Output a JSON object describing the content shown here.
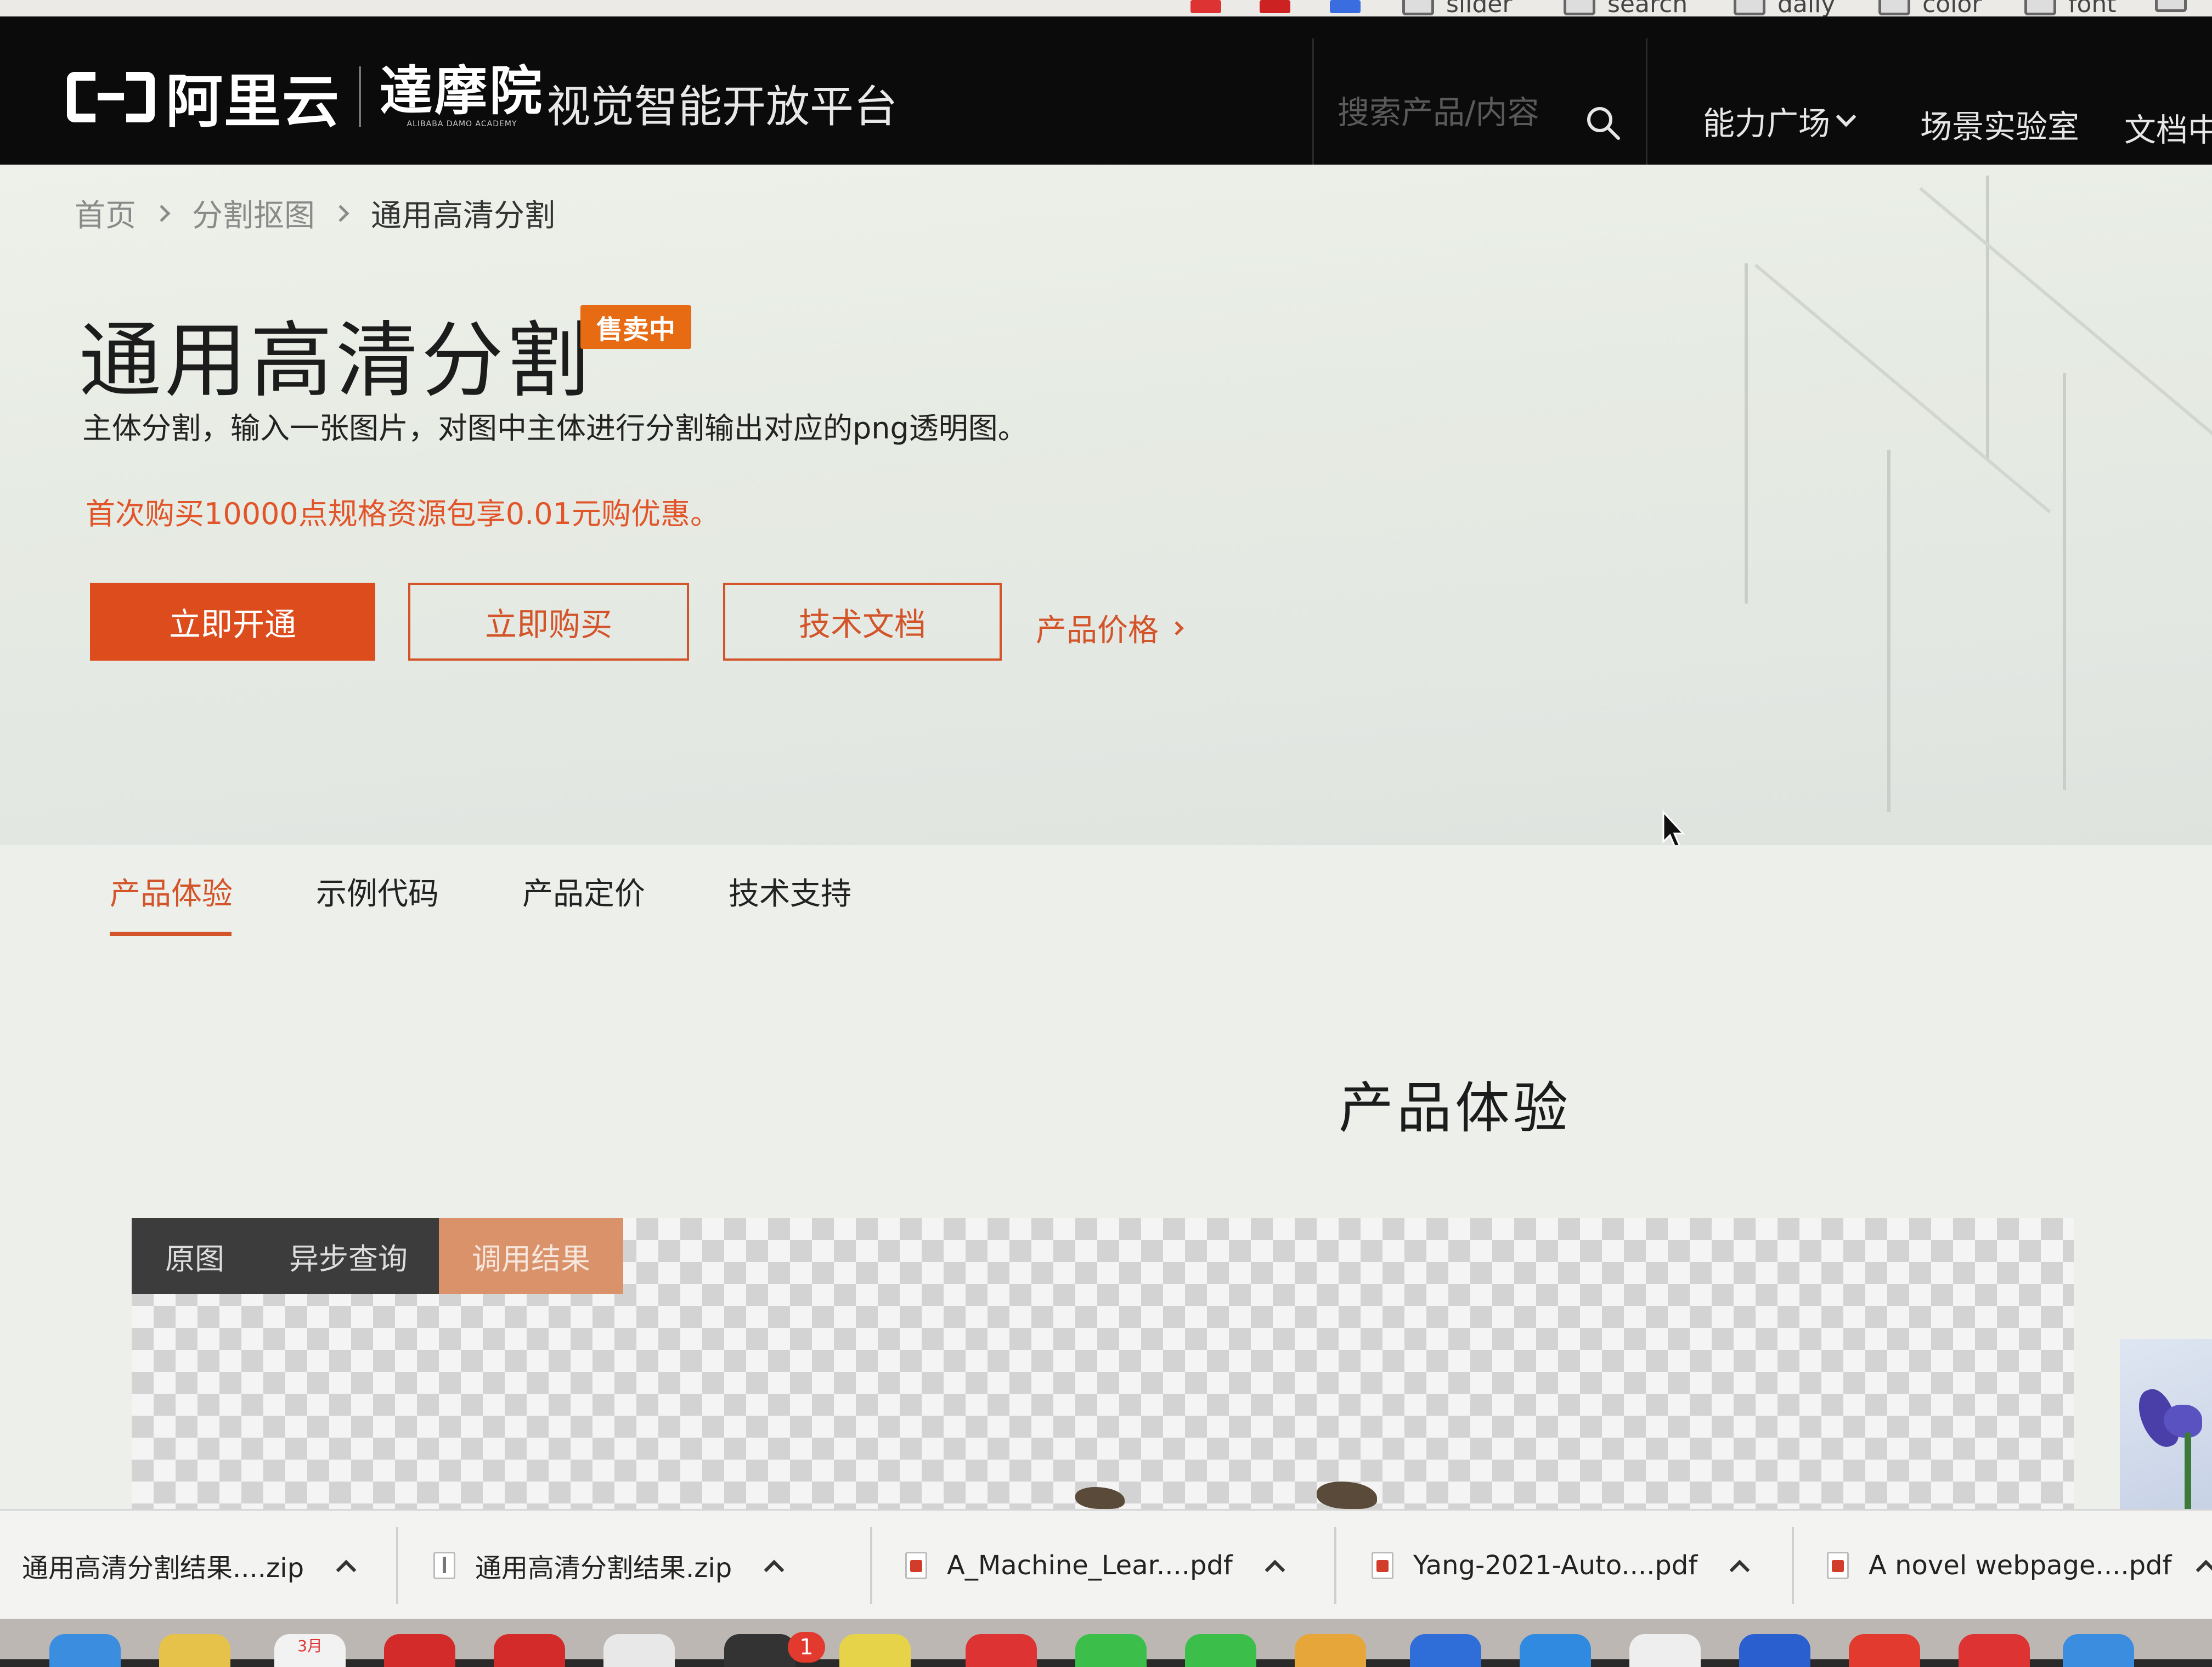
{
  "bookmarks": [
    "slider",
    "search",
    "daily",
    "color",
    "font"
  ],
  "header": {
    "logo_text": "阿里云",
    "damo_cn": "達摩院",
    "damo_en": "ALIBABA DAMO ACADEMY",
    "platform_title": "视觉智能开放平台",
    "search_placeholder": "搜索产品/内容",
    "nav": {
      "ability_square": "能力广场",
      "scene_lab": "场景实验室",
      "docs": "文档中"
    }
  },
  "breadcrumb": {
    "home": "首页",
    "category": "分割抠图",
    "current": "通用高清分割"
  },
  "product": {
    "title": "通用高清分割",
    "badge": "售卖中",
    "description": "主体分割，输入一张图片，对图中主体进行分割输出对应的png透明图。",
    "promo": "首次购买10000点规格资源包享0.01元购优惠。"
  },
  "buttons": {
    "activate": "立即开通",
    "buy": "立即购买",
    "docs": "技术文档",
    "pricing_link": "产品价格"
  },
  "tabs": [
    "产品体验",
    "示例代码",
    "产品定价",
    "技术支持"
  ],
  "active_tab": "产品体验",
  "section_title": "产品体验",
  "preview_tabs": {
    "original": "原图",
    "async_query": "异步查询",
    "result": "调用结果"
  },
  "downloads": [
    {
      "name": "通用高清分割结果....zip"
    },
    {
      "name": "通用高清分割结果.zip"
    },
    {
      "name": "A_Machine_Lear....pdf"
    },
    {
      "name": "Yang-2021-Auto....pdf"
    },
    {
      "name": "A novel webpage....pdf"
    }
  ],
  "dock": {
    "badge_count": "1",
    "calendar_month": "3月"
  },
  "colors": {
    "accent": "#dc4c1c",
    "badge": "#e66b12",
    "header_bg": "#0b0b0b"
  }
}
